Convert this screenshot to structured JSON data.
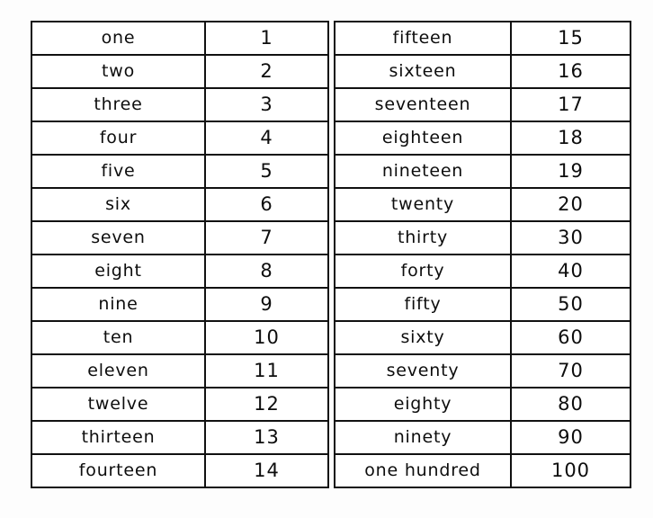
{
  "page": {
    "background_color": "#fdfdfd",
    "border_color": "#111111",
    "cell_background": "#ffffff",
    "text_color": "#0d0d0d"
  },
  "tables": [
    {
      "name": "left-table",
      "columns": [
        "word",
        "numeral"
      ],
      "rows": [
        {
          "word": "one",
          "numeral": "1"
        },
        {
          "word": "two",
          "numeral": "2"
        },
        {
          "word": "three",
          "numeral": "3"
        },
        {
          "word": "four",
          "numeral": "4"
        },
        {
          "word": "five",
          "numeral": "5"
        },
        {
          "word": "six",
          "numeral": "6"
        },
        {
          "word": "seven",
          "numeral": "7"
        },
        {
          "word": "eight",
          "numeral": "8"
        },
        {
          "word": "nine",
          "numeral": "9"
        },
        {
          "word": "ten",
          "numeral": "10"
        },
        {
          "word": "eleven",
          "numeral": "11"
        },
        {
          "word": "twelve",
          "numeral": "12"
        },
        {
          "word": "thirteen",
          "numeral": "13"
        },
        {
          "word": "fourteen",
          "numeral": "14"
        }
      ]
    },
    {
      "name": "right-table",
      "columns": [
        "word",
        "numeral"
      ],
      "rows": [
        {
          "word": "fifteen",
          "numeral": "15"
        },
        {
          "word": "sixteen",
          "numeral": "16"
        },
        {
          "word": "seventeen",
          "numeral": "17"
        },
        {
          "word": "eighteen",
          "numeral": "18"
        },
        {
          "word": "nineteen",
          "numeral": "19"
        },
        {
          "word": "twenty",
          "numeral": "20"
        },
        {
          "word": "thirty",
          "numeral": "30"
        },
        {
          "word": "forty",
          "numeral": "40"
        },
        {
          "word": "fifty",
          "numeral": "50"
        },
        {
          "word": "sixty",
          "numeral": "60"
        },
        {
          "word": "seventy",
          "numeral": "70"
        },
        {
          "word": "eighty",
          "numeral": "80"
        },
        {
          "word": "ninety",
          "numeral": "90"
        },
        {
          "word": "one hundred",
          "numeral": "100"
        }
      ]
    }
  ]
}
